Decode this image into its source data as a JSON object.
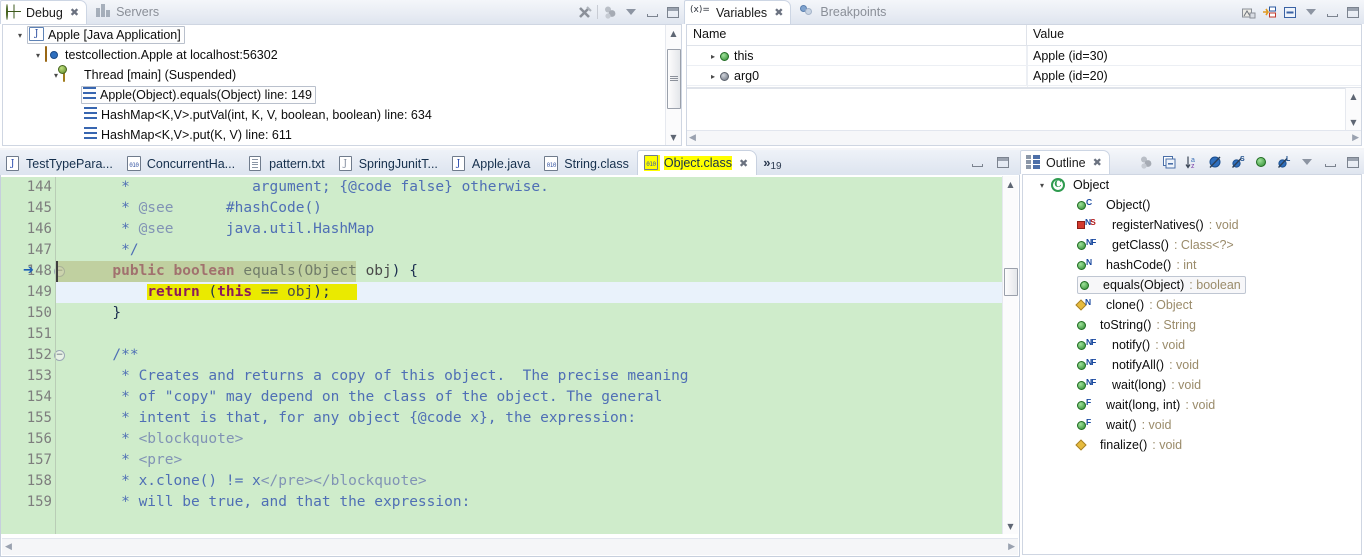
{
  "debug_view": {
    "tabs": [
      {
        "label": "Debug",
        "icon": "bug-icon",
        "active": true,
        "closable": true
      },
      {
        "label": "Servers",
        "icon": "servers-icon",
        "active": false,
        "closable": false
      }
    ],
    "toolbar": [
      {
        "name": "remove-all-terminated-icon"
      },
      {
        "name": "view-menu-collapse-icon"
      },
      {
        "name": "view-menu-icon"
      },
      {
        "name": "minimize-icon"
      },
      {
        "name": "maximize-icon"
      }
    ],
    "tree": [
      {
        "label": "Apple [Java Application]",
        "icon": "launch-config-icon",
        "indent": 0,
        "twisty": "expanded",
        "selected": true
      },
      {
        "label": "testcollection.Apple at localhost:56302",
        "icon": "debug-target-icon",
        "indent": 1,
        "twisty": "expanded",
        "selected": false
      },
      {
        "label": "Thread [main] (Suspended)",
        "icon": "thread-icon",
        "indent": 2,
        "twisty": "expanded",
        "selected": false
      },
      {
        "label": "Apple(Object).equals(Object) line: 149",
        "icon": "stack-frame-icon",
        "indent": 3,
        "twisty": "none",
        "selected": true
      },
      {
        "label": "HashMap<K,V>.putVal(int, K, V, boolean, boolean) line: 634",
        "icon": "stack-frame-icon",
        "indent": 3,
        "twisty": "none",
        "selected": false
      },
      {
        "label": "HashMap<K,V>.put(K, V) line: 611",
        "icon": "stack-frame-icon",
        "indent": 3,
        "twisty": "none",
        "selected": false
      }
    ]
  },
  "variables_view": {
    "tabs": [
      {
        "label": "Variables",
        "icon": "variables-icon",
        "active": true,
        "closable": true
      },
      {
        "label": "Breakpoints",
        "icon": "breakpoints-icon",
        "active": false,
        "closable": false
      }
    ],
    "toolbar": [
      {
        "name": "show-logical-structure-icon"
      },
      {
        "name": "collapse-all-icon"
      },
      {
        "name": "layout-icon"
      },
      {
        "name": "view-menu-icon"
      },
      {
        "name": "minimize-icon"
      },
      {
        "name": "maximize-icon"
      }
    ],
    "columns": [
      "Name",
      "Value"
    ],
    "rows": [
      {
        "name": "this",
        "value": "Apple  (id=30)",
        "icon": "object-green-dot",
        "twisty": "collapsed"
      },
      {
        "name": "arg0",
        "value": "Apple  (id=20)",
        "icon": "object-grey-dot",
        "twisty": "collapsed"
      }
    ]
  },
  "editor": {
    "tabs": [
      {
        "label": "TestTypePara...",
        "icon": "java-file-icon",
        "active": false,
        "closable": false
      },
      {
        "label": "ConcurrentHa...",
        "icon": "class-file-icon",
        "active": false,
        "closable": false
      },
      {
        "label": "pattern.txt",
        "icon": "text-file-icon",
        "active": false,
        "closable": false
      },
      {
        "label": "SpringJunitT...",
        "icon": "java-file-icon",
        "active": false,
        "closable": false
      },
      {
        "label": "Apple.java",
        "icon": "java-file-icon",
        "active": false,
        "closable": false
      },
      {
        "label": "String.class",
        "icon": "class-file-icon",
        "active": false,
        "closable": false
      },
      {
        "label": "Object.class",
        "icon": "class-file-icon",
        "active": true,
        "closable": true,
        "highlighted": true
      }
    ],
    "overflow_count": "19",
    "overflow_symbol": "»",
    "window_buttons": [
      {
        "name": "minimize-icon"
      },
      {
        "name": "maximize-icon"
      }
    ],
    "first_line_number": 144,
    "current_line": 149,
    "lines": [
      {
        "num": 144,
        "fold": false,
        "tokens": [
          {
            "t": "       * ",
            "c": "com"
          },
          {
            "t": "             argument; {@code false} otherwise.",
            "c": "com"
          }
        ]
      },
      {
        "num": 145,
        "fold": false,
        "tokens": [
          {
            "t": "       * ",
            "c": "com"
          },
          {
            "t": "@see",
            "c": "comtag"
          },
          {
            "t": "      #hashCode()",
            "c": "com"
          }
        ]
      },
      {
        "num": 146,
        "fold": false,
        "tokens": [
          {
            "t": "       * ",
            "c": "com"
          },
          {
            "t": "@see",
            "c": "comtag"
          },
          {
            "t": "      java.util.HashMap",
            "c": "com"
          }
        ]
      },
      {
        "num": 147,
        "fold": false,
        "tokens": [
          {
            "t": "       */",
            "c": "com"
          }
        ]
      },
      {
        "num": 148,
        "fold": true,
        "tokens": [
          {
            "t": "      ",
            "c": "txt"
          },
          {
            "t": "public boolean",
            "c": "kw"
          },
          {
            "t": " equals(",
            "c": "txt"
          },
          {
            "t": "Object",
            "c": "txt"
          },
          {
            "t": " obj",
            "c": "par"
          },
          {
            "t": ") {",
            "c": "txt"
          }
        ]
      },
      {
        "num": 149,
        "fold": false,
        "current": true,
        "tokens": [
          {
            "t": "          ",
            "c": "txt"
          },
          {
            "t": "return",
            "c": "kw",
            "hl": true
          },
          {
            "t": " (",
            "c": "txt",
            "hl": true
          },
          {
            "t": "this",
            "c": "kw",
            "hl": true
          },
          {
            "t": " == ",
            "c": "txt",
            "hl": true
          },
          {
            "t": "obj",
            "c": "par",
            "hl": true
          },
          {
            "t": ");",
            "c": "txt",
            "hl": true
          },
          {
            "t": "   ",
            "c": "txt",
            "hl": true
          }
        ]
      },
      {
        "num": 150,
        "fold": false,
        "tokens": [
          {
            "t": "      }",
            "c": "txt"
          }
        ]
      },
      {
        "num": 151,
        "fold": false,
        "tokens": [
          {
            "t": "",
            "c": "txt"
          }
        ]
      },
      {
        "num": 152,
        "fold": true,
        "tokens": [
          {
            "t": "      /**",
            "c": "com"
          }
        ]
      },
      {
        "num": 153,
        "fold": false,
        "tokens": [
          {
            "t": "       * Creates and returns a copy of this object.  The precise meaning",
            "c": "com"
          }
        ]
      },
      {
        "num": 154,
        "fold": false,
        "tokens": [
          {
            "t": "       * of \"copy\" may depend on the class of the object. The general",
            "c": "com"
          }
        ]
      },
      {
        "num": 155,
        "fold": false,
        "tokens": [
          {
            "t": "       * intent is that, for any object {@code x}, the expression:",
            "c": "com"
          }
        ]
      },
      {
        "num": 156,
        "fold": false,
        "tokens": [
          {
            "t": "       * ",
            "c": "com"
          },
          {
            "t": "<blockquote>",
            "c": "comtag"
          }
        ]
      },
      {
        "num": 157,
        "fold": false,
        "tokens": [
          {
            "t": "       * ",
            "c": "com"
          },
          {
            "t": "<pre>",
            "c": "comtag"
          }
        ]
      },
      {
        "num": 158,
        "fold": false,
        "tokens": [
          {
            "t": "       * x.clone() != x",
            "c": "com"
          },
          {
            "t": "</pre></blockquote>",
            "c": "comtag"
          }
        ]
      },
      {
        "num": 159,
        "fold": false,
        "tokens": [
          {
            "t": "       * will be true, and that the expression:",
            "c": "com"
          }
        ]
      }
    ]
  },
  "outline_view": {
    "tabs": [
      {
        "label": "Outline",
        "icon": "outline-icon",
        "active": true,
        "closable": true
      }
    ],
    "toolbar": [
      {
        "name": "focus-on-active-task-icon"
      },
      {
        "name": "collapse-all-icon"
      },
      {
        "name": "sort-icon"
      },
      {
        "name": "hide-fields-icon"
      },
      {
        "name": "hide-static-icon"
      },
      {
        "name": "show-public-icon"
      },
      {
        "name": "hide-local-types-icon"
      },
      {
        "name": "view-menu-icon"
      },
      {
        "name": "minimize-icon"
      },
      {
        "name": "maximize-icon"
      }
    ],
    "root": {
      "label": "Object",
      "icon": "class-icon",
      "twisty": "expanded"
    },
    "members": [
      {
        "name": "Object()",
        "type": "",
        "icon": "green-dot",
        "badges": [
          "C"
        ],
        "selected": false
      },
      {
        "name": "registerNatives()",
        "type": " : void",
        "icon": "red-square",
        "badges": [
          "N",
          "S"
        ],
        "selected": false
      },
      {
        "name": "getClass()",
        "type": " : Class<?>",
        "icon": "green-dot",
        "badges": [
          "N",
          "F"
        ],
        "selected": false
      },
      {
        "name": "hashCode()",
        "type": " : int",
        "icon": "green-dot",
        "badges": [
          "N"
        ],
        "selected": false
      },
      {
        "name": "equals(Object)",
        "type": " : boolean",
        "icon": "green-dot",
        "badges": [],
        "selected": true
      },
      {
        "name": "clone()",
        "type": " : Object",
        "icon": "diamond",
        "badges": [
          "N"
        ],
        "selected": false
      },
      {
        "name": "toString()",
        "type": " : String",
        "icon": "green-dot",
        "badges": [],
        "selected": false
      },
      {
        "name": "notify()",
        "type": " : void",
        "icon": "green-dot",
        "badges": [
          "N",
          "F"
        ],
        "selected": false
      },
      {
        "name": "notifyAll()",
        "type": " : void",
        "icon": "green-dot",
        "badges": [
          "N",
          "F"
        ],
        "selected": false
      },
      {
        "name": "wait(long)",
        "type": " : void",
        "icon": "green-dot",
        "badges": [
          "N",
          "F"
        ],
        "selected": false
      },
      {
        "name": "wait(long, int)",
        "type": " : void",
        "icon": "green-dot",
        "badges": [
          "F"
        ],
        "selected": false
      },
      {
        "name": "wait()",
        "type": " : void",
        "icon": "green-dot",
        "badges": [
          "F"
        ],
        "selected": false
      },
      {
        "name": "finalize()",
        "type": " : void",
        "icon": "diamond",
        "badges": [],
        "selected": false
      }
    ]
  },
  "colors": {
    "editor_background": "#cfeccb",
    "current_line": "#e9f2fb",
    "search_highlight": "#ffff00",
    "keyword": "#8b1a5c",
    "comment": "#4f6fb5",
    "tab_highlight": "#ffff00"
  }
}
